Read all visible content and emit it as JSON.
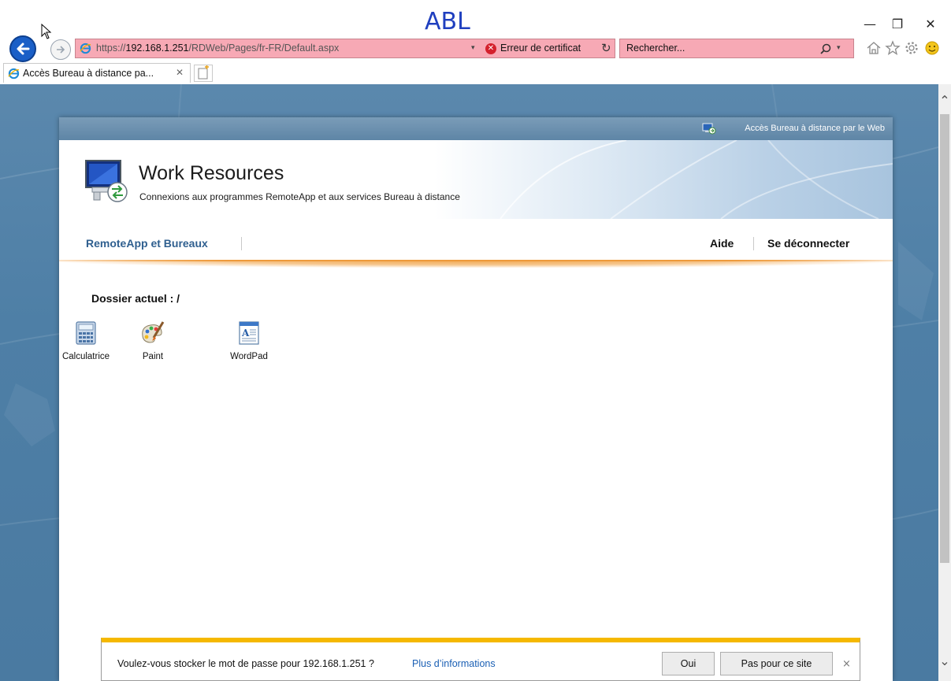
{
  "annotation": {
    "ink_text": "ABL"
  },
  "window": {
    "minimize_glyph": "—",
    "restore_glyph": "❐",
    "close_glyph": "✕"
  },
  "address_bar": {
    "url_prefix": "https://",
    "url_host": "192.168.1.251",
    "url_path": "/RDWeb/Pages/fr-FR/Default.aspx",
    "cert_error": "Erreur de certificat",
    "dropdown_glyph": "▾",
    "refresh_glyph": "↻"
  },
  "search": {
    "placeholder": "Rechercher...",
    "dropdown_glyph": "▾"
  },
  "toolbar_icons": [
    "home-icon",
    "favorites-star-icon",
    "settings-gear-icon",
    "feedback-smiley-icon"
  ],
  "tab": {
    "title": "Accès Bureau à distance pa...",
    "close_glyph": "✕"
  },
  "rdweb": {
    "topstrip_label": "Accès Bureau à distance par le Web",
    "title": "Work Resources",
    "subtitle": "Connexions aux programmes RemoteApp et aux services Bureau à distance",
    "nav": {
      "remoteapp": "RemoteApp et Bureaux",
      "help": "Aide",
      "logout": "Se déconnecter"
    },
    "current_folder": "Dossier actuel : /",
    "apps": [
      {
        "label": "Calculatrice",
        "icon": "calculator-icon"
      },
      {
        "label": "Paint",
        "icon": "paint-palette-icon"
      },
      {
        "label": "WordPad",
        "icon": "wordpad-icon"
      }
    ]
  },
  "notification": {
    "message": "Voulez-vous stocker le mot de passe pour 192.168.1.251 ?",
    "more_info": "Plus d’informations",
    "yes": "Oui",
    "no": "Pas pour ce site",
    "close_glyph": "×"
  },
  "scrollbar": {
    "up_glyph": "⌃",
    "down_glyph": "⌄"
  },
  "colors": {
    "address_error_bg": "#f7a9b5",
    "back_button": "#1a5fc7",
    "nav_link": "#2f5f8f",
    "accent_orange": "#ee9a3b",
    "notification_accent": "#f5b800",
    "link_blue": "#1a5fb4"
  }
}
